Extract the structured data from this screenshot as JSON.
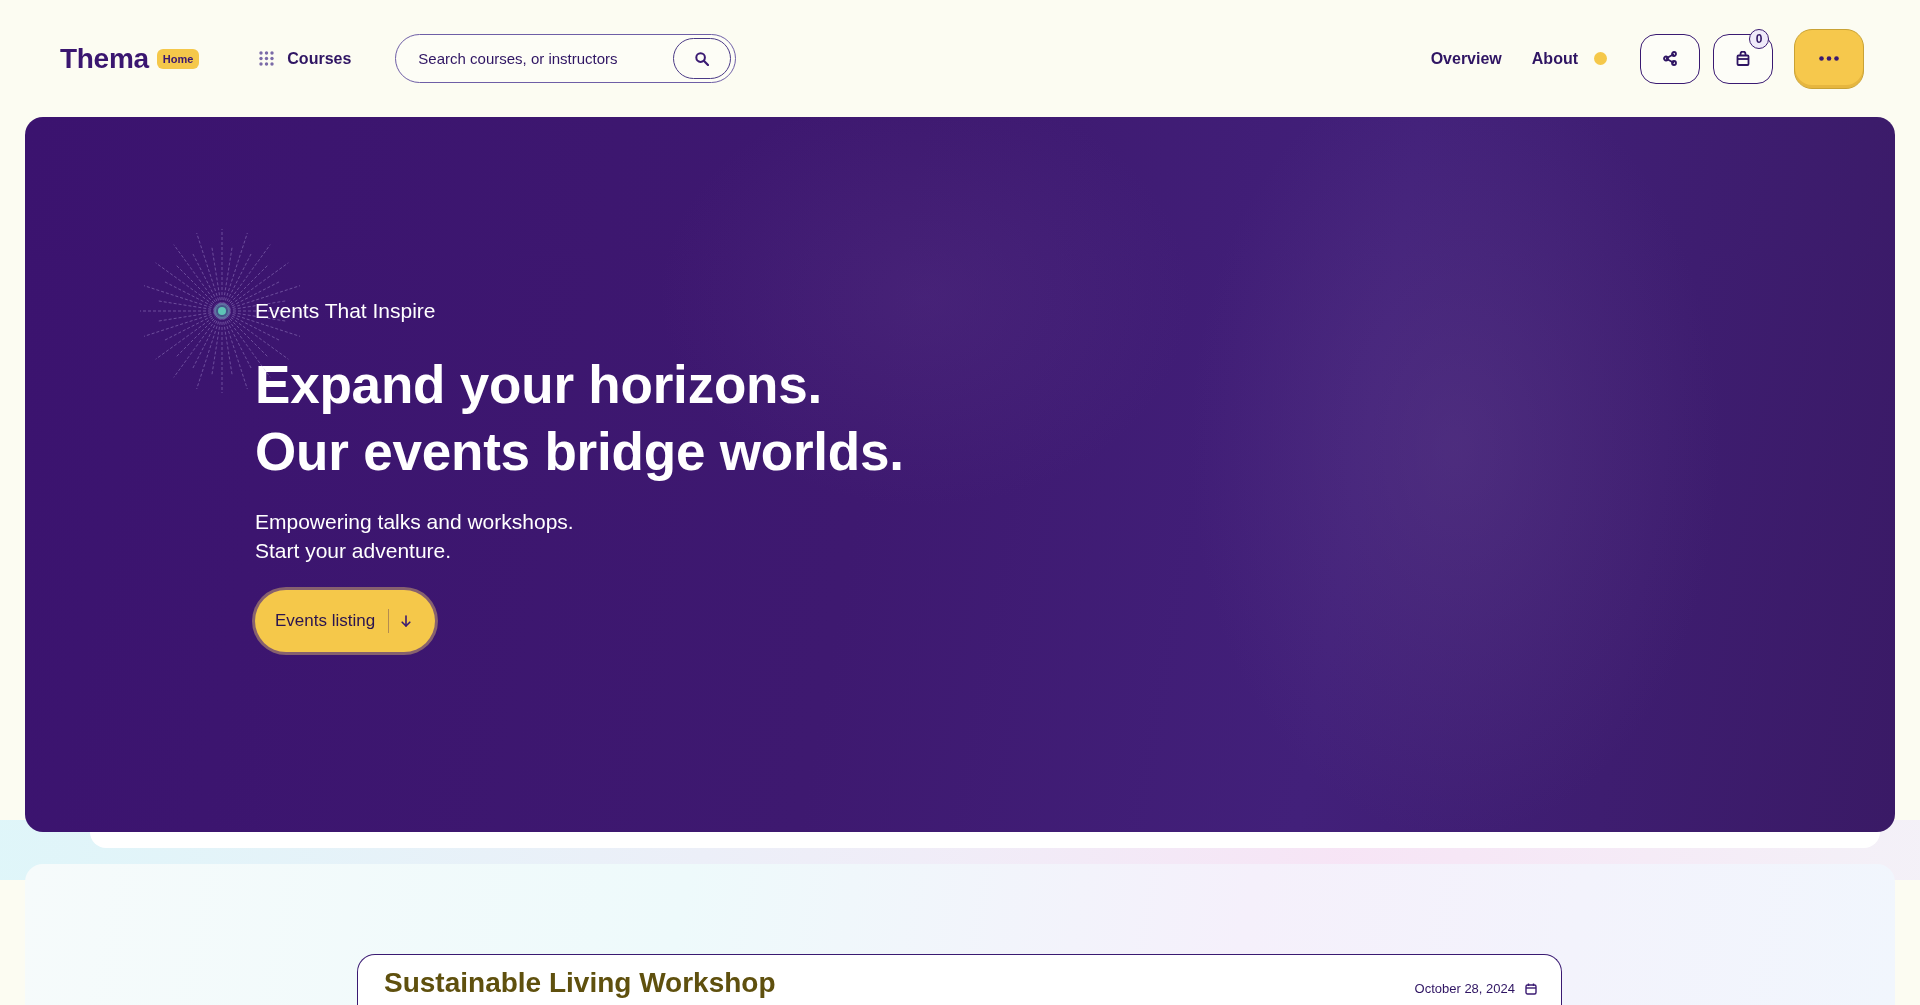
{
  "header": {
    "logo": "Thema",
    "logo_badge": "Home",
    "menu": {
      "label": "Courses"
    },
    "search": {
      "placeholder": "Search courses, or instructors"
    },
    "links": [
      {
        "label": "Overview",
        "indicator": false
      },
      {
        "label": "About",
        "indicator": true
      }
    ],
    "cart": {
      "count": "0"
    }
  },
  "hero": {
    "eyebrow": "Events That Inspire",
    "headline": [
      "Expand your horizons.",
      "Our events bridge worlds."
    ],
    "subtitle": [
      "Empowering talks and workshops.",
      "Start your adventure."
    ],
    "button": "Events listing"
  },
  "events": [
    {
      "title": "Sustainable Living Workshop",
      "date": "October 28, 2024"
    }
  ]
}
